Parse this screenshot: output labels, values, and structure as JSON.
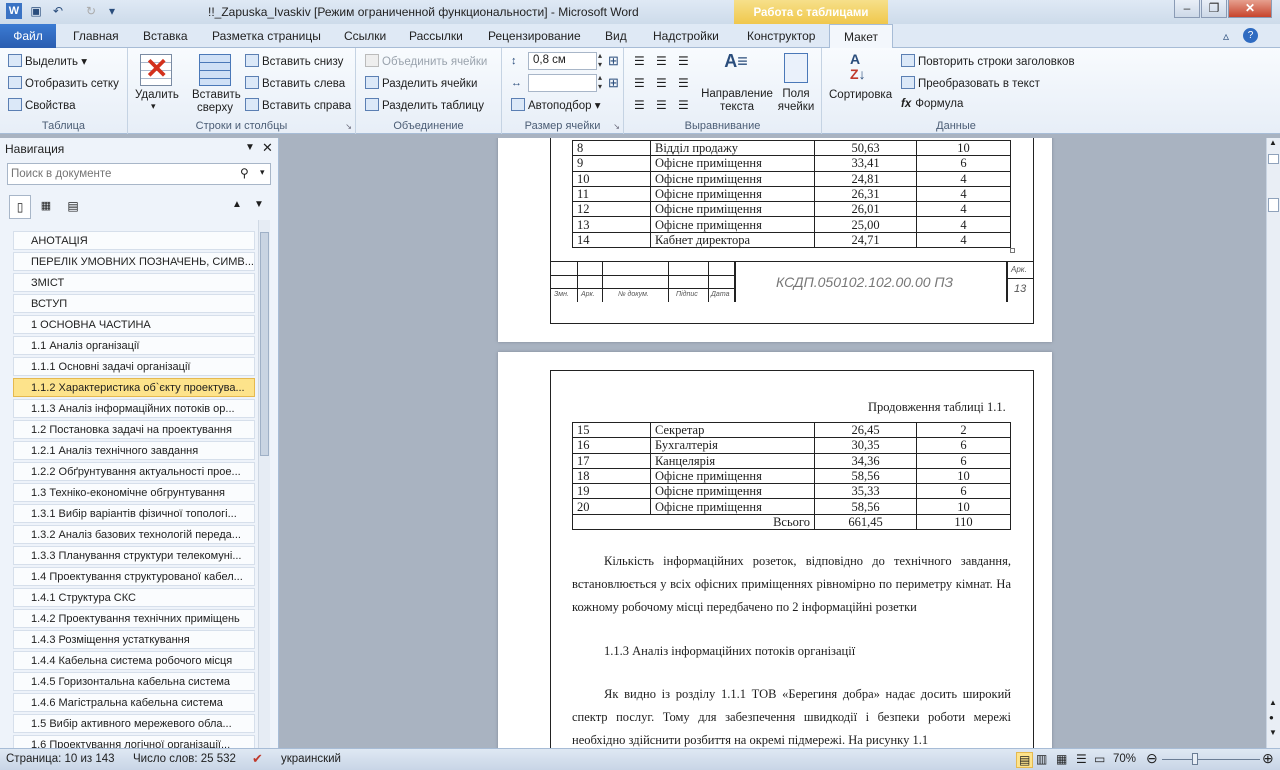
{
  "window": {
    "title": "!!_Zapuska_Ivaskiv [Режим ограниченной функциональности] - Microsoft Word",
    "context_tab": "Работа с таблицами"
  },
  "tabs": [
    "Файл",
    "Главная",
    "Вставка",
    "Разметка страницы",
    "Ссылки",
    "Рассылки",
    "Рецензирование",
    "Вид",
    "Надстройки",
    "Конструктор",
    "Макет"
  ],
  "ribbon": {
    "table": {
      "select": "Выделить",
      "gridlines": "Отобразить сетку",
      "properties": "Свойства",
      "label": "Таблица"
    },
    "rows": {
      "delete": "Удалить",
      "insert_above": "Вставить сверху",
      "below": "Вставить снизу",
      "left": "Вставить слева",
      "right": "Вставить справа",
      "label": "Строки и столбцы"
    },
    "merge": {
      "merge_cells": "Объединить ячейки",
      "split_cells": "Разделить ячейки",
      "split_table": "Разделить таблицу",
      "label": "Объединение"
    },
    "size": {
      "height": "0,8 см",
      "autofit": "Автоподбор",
      "label": "Размер ячейки"
    },
    "align": {
      "direction": "Направление текста",
      "margins": "Поля ячейки",
      "label": "Выравнивание"
    },
    "data": {
      "sort": "Сортировка",
      "repeat": "Повторить строки заголовков",
      "convert": "Преобразовать в текст",
      "formula": "Формула",
      "label": "Данные"
    }
  },
  "nav": {
    "title": "Навигация",
    "search_placeholder": "Поиск в документе",
    "items": [
      "АНОТАЦІЯ",
      "ПЕРЕЛІК УМОВНИХ ПОЗНАЧЕНЬ, СИМВ...",
      "ЗМІСТ",
      "ВСТУП",
      "1 ОСНОВНА ЧАСТИНА",
      "1.1 Аналіз організації",
      "1.1.1 Основні задачі організації",
      "1.1.2 Характеристика об`єкту проектува...",
      "1.1.3 Аналіз інформаційних потоків ор...",
      "1.2 Постановка задачі на проектування",
      "1.2.1 Аналіз технічного завдання",
      "1.2.2 Обґрунтування актуальності прое...",
      "1.3 Техніко-економічне обгрунтування",
      "1.3.1 Вибір варіантів фізичної топологі...",
      "1.3.2 Аналіз базових технологій переда...",
      "1.3.3 Планування структури телекомуні...",
      "1.4 Проектування структурованої кабел...",
      "1.4.1 Структура СКС",
      "1.4.2 Проектування технічних приміщень",
      "1.4.3 Розміщення устаткування",
      "1.4.4 Кабельна система робочого місця",
      "1.4.5 Горизонтальна кабельна система",
      "1.4.6 Магістральна кабельна система",
      "1.5 Вибір активного мережевого обла...",
      "1.6 Проектування логічної організації..."
    ]
  },
  "doc": {
    "table1": [
      [
        "8",
        "Відділ продажу",
        "50,63",
        "10"
      ],
      [
        "9",
        "Офісне приміщення",
        "33,41",
        "6"
      ],
      [
        "10",
        "Офісне приміщення",
        "24,81",
        "4"
      ],
      [
        "11",
        "Офісне приміщення",
        "26,31",
        "4"
      ],
      [
        "12",
        "Офісне приміщення",
        "26,01",
        "4"
      ],
      [
        "13",
        "Офісне приміщення",
        "25,00",
        "4"
      ],
      [
        "14",
        "Кабнет директора",
        "24,71",
        "4"
      ]
    ],
    "stamp": {
      "doc_code": "КСДП.050102.102.00.00  ПЗ",
      "ark": "Арк.",
      "page": "13",
      "zmn": "Змн.",
      "ark2": "Арк.",
      "docnum": "№ докум.",
      "sign": "Підпис",
      "date": "Дата"
    },
    "continuation": "Продовження таблиці 1.1.",
    "table2": [
      [
        "15",
        "Секретар",
        "26,45",
        "2"
      ],
      [
        "16",
        "Бухгалтерія",
        "30,35",
        "6"
      ],
      [
        "17",
        "Канцелярія",
        "34,36",
        "6"
      ],
      [
        "18",
        "Офісне приміщення",
        "58,56",
        "10"
      ],
      [
        "19",
        "Офісне приміщення",
        "35,33",
        "6"
      ],
      [
        "20",
        "Офісне приміщення",
        "58,56",
        "10"
      ]
    ],
    "total": {
      "label": "Всього",
      "area": "661,45",
      "count": "110"
    },
    "para1": "Кількість інформаційних розеток, відповідно до технічного завдання, встановлюється у всіх офісних приміщеннях рівномірно по периметру кімнат. На кожному робочому місці передбачено по 2 інформаційні розетки",
    "heading": "1.1.3  Аналіз інформаційних потоків організації",
    "para2": "Як видно із розділу 1.1.1 ТОВ «Берегиня добра» надає досить широкий спектр послуг. Тому для забезпечення швидкодії і безпеки роботи мережі необхідно здійснити розбиття на окремі підмережі. На рисунку 1.1"
  },
  "status": {
    "page": "Страница: 10 из 143",
    "words": "Число слов: 25 532",
    "lang": "украинский",
    "zoom": "70%"
  }
}
